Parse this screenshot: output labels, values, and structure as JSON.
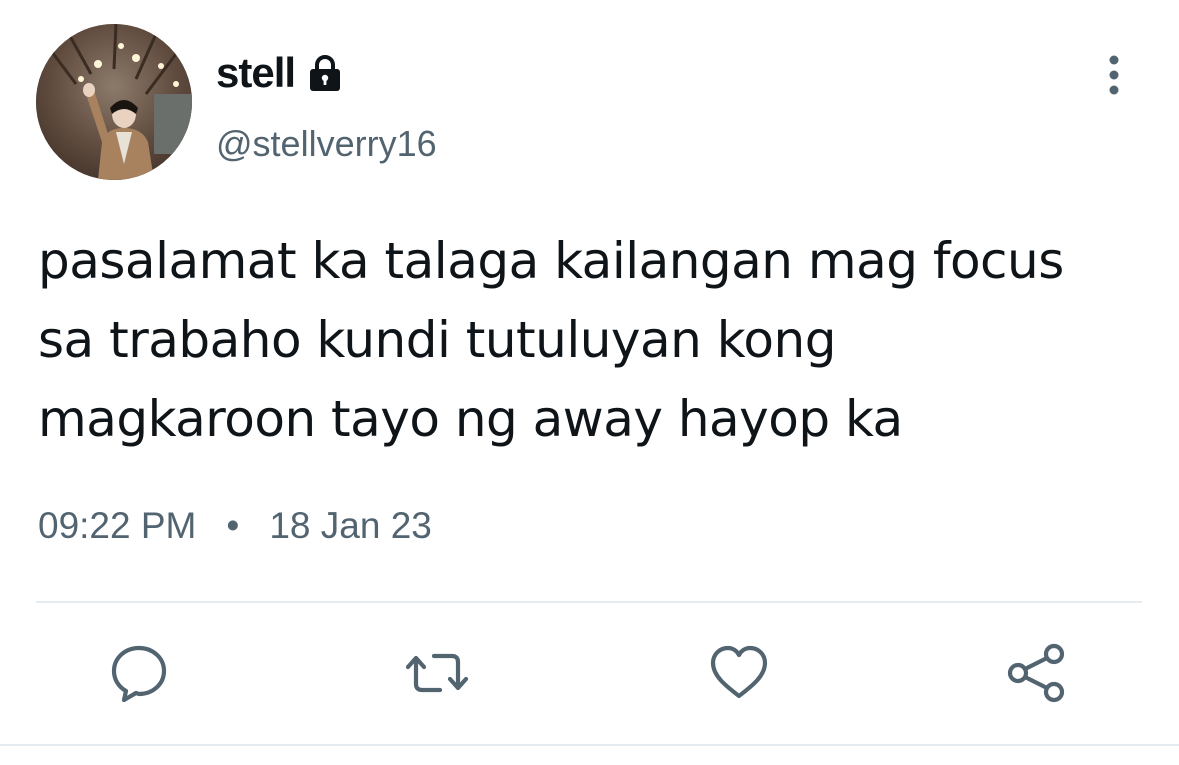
{
  "tweet": {
    "author": {
      "display_name": "stell",
      "handle": "@stellverry16",
      "protected_icon": "lock-icon",
      "avatar": "profile-photo"
    },
    "text": "pasalamat ka talaga kailangan mag focus\nsa trabaho kundi tutuluyan kong\nmagkaroon tayo ng away hayop ka",
    "time": "09:22 PM",
    "separator": "•",
    "date": "18 Jan 23"
  },
  "actions": [
    {
      "name": "reply",
      "icon": "reply-icon"
    },
    {
      "name": "retweet",
      "icon": "retweet-icon"
    },
    {
      "name": "like",
      "icon": "heart-icon"
    },
    {
      "name": "share",
      "icon": "share-icon"
    }
  ],
  "menu_icon": "more-vertical-icon",
  "colors": {
    "text_primary": "#0f1419",
    "text_secondary": "#536471",
    "divider": "#e6ecf0",
    "background": "#ffffff"
  }
}
